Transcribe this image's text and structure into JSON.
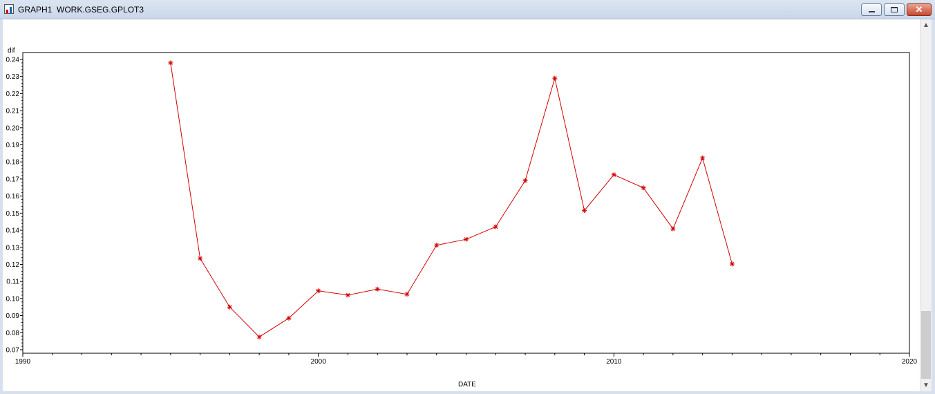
{
  "window": {
    "title": "GRAPH1  WORK.GSEG.GPLOT3",
    "icons": {
      "app": "sas-graph-icon",
      "minimize": "minimize-icon",
      "maximize": "maximize-icon",
      "close": "close-icon"
    },
    "close_glyph": "✕",
    "scroll_up_glyph": "▲",
    "scroll_down_glyph": "▼"
  },
  "colors": {
    "series": "#d40000",
    "axis": "#000000",
    "background": "#ffffff"
  },
  "chart_data": {
    "type": "line",
    "title": "",
    "xlabel": "DATE",
    "ylabel": "dif",
    "xlim": [
      1990,
      2020
    ],
    "ylim": [
      0.07,
      0.24
    ],
    "x_ticks": [
      1990,
      2000,
      2010,
      2020
    ],
    "x_tick_labels": [
      "1990",
      "2000",
      "2010",
      "2020"
    ],
    "y_ticks": [
      0.07,
      0.08,
      0.09,
      0.1,
      0.11,
      0.12,
      0.13,
      0.14,
      0.15,
      0.16,
      0.17,
      0.18,
      0.19,
      0.2,
      0.21,
      0.22,
      0.23,
      0.24
    ],
    "y_tick_labels": [
      "0.07",
      "0.08",
      "0.09",
      "0.10",
      "0.11",
      "0.12",
      "0.13",
      "0.14",
      "0.15",
      "0.16",
      "0.17",
      "0.18",
      "0.19",
      "0.20",
      "0.21",
      "0.22",
      "0.23",
      "0.24"
    ],
    "marker": "star",
    "grid": false,
    "series": [
      {
        "x": [
          1995,
          1996,
          1997,
          1998,
          1999,
          2000,
          2001,
          2002,
          2003,
          2004,
          2005,
          2006,
          2007,
          2008,
          2009,
          2010,
          2011,
          2012,
          2013,
          2014
        ],
        "y": [
          0.238,
          0.1235,
          0.095,
          0.0775,
          0.0885,
          0.1045,
          0.102,
          0.1055,
          0.1025,
          0.1312,
          0.1347,
          0.142,
          0.169,
          0.229,
          0.1515,
          0.1725,
          0.1648,
          0.1408,
          0.1823,
          0.1202
        ]
      }
    ]
  }
}
